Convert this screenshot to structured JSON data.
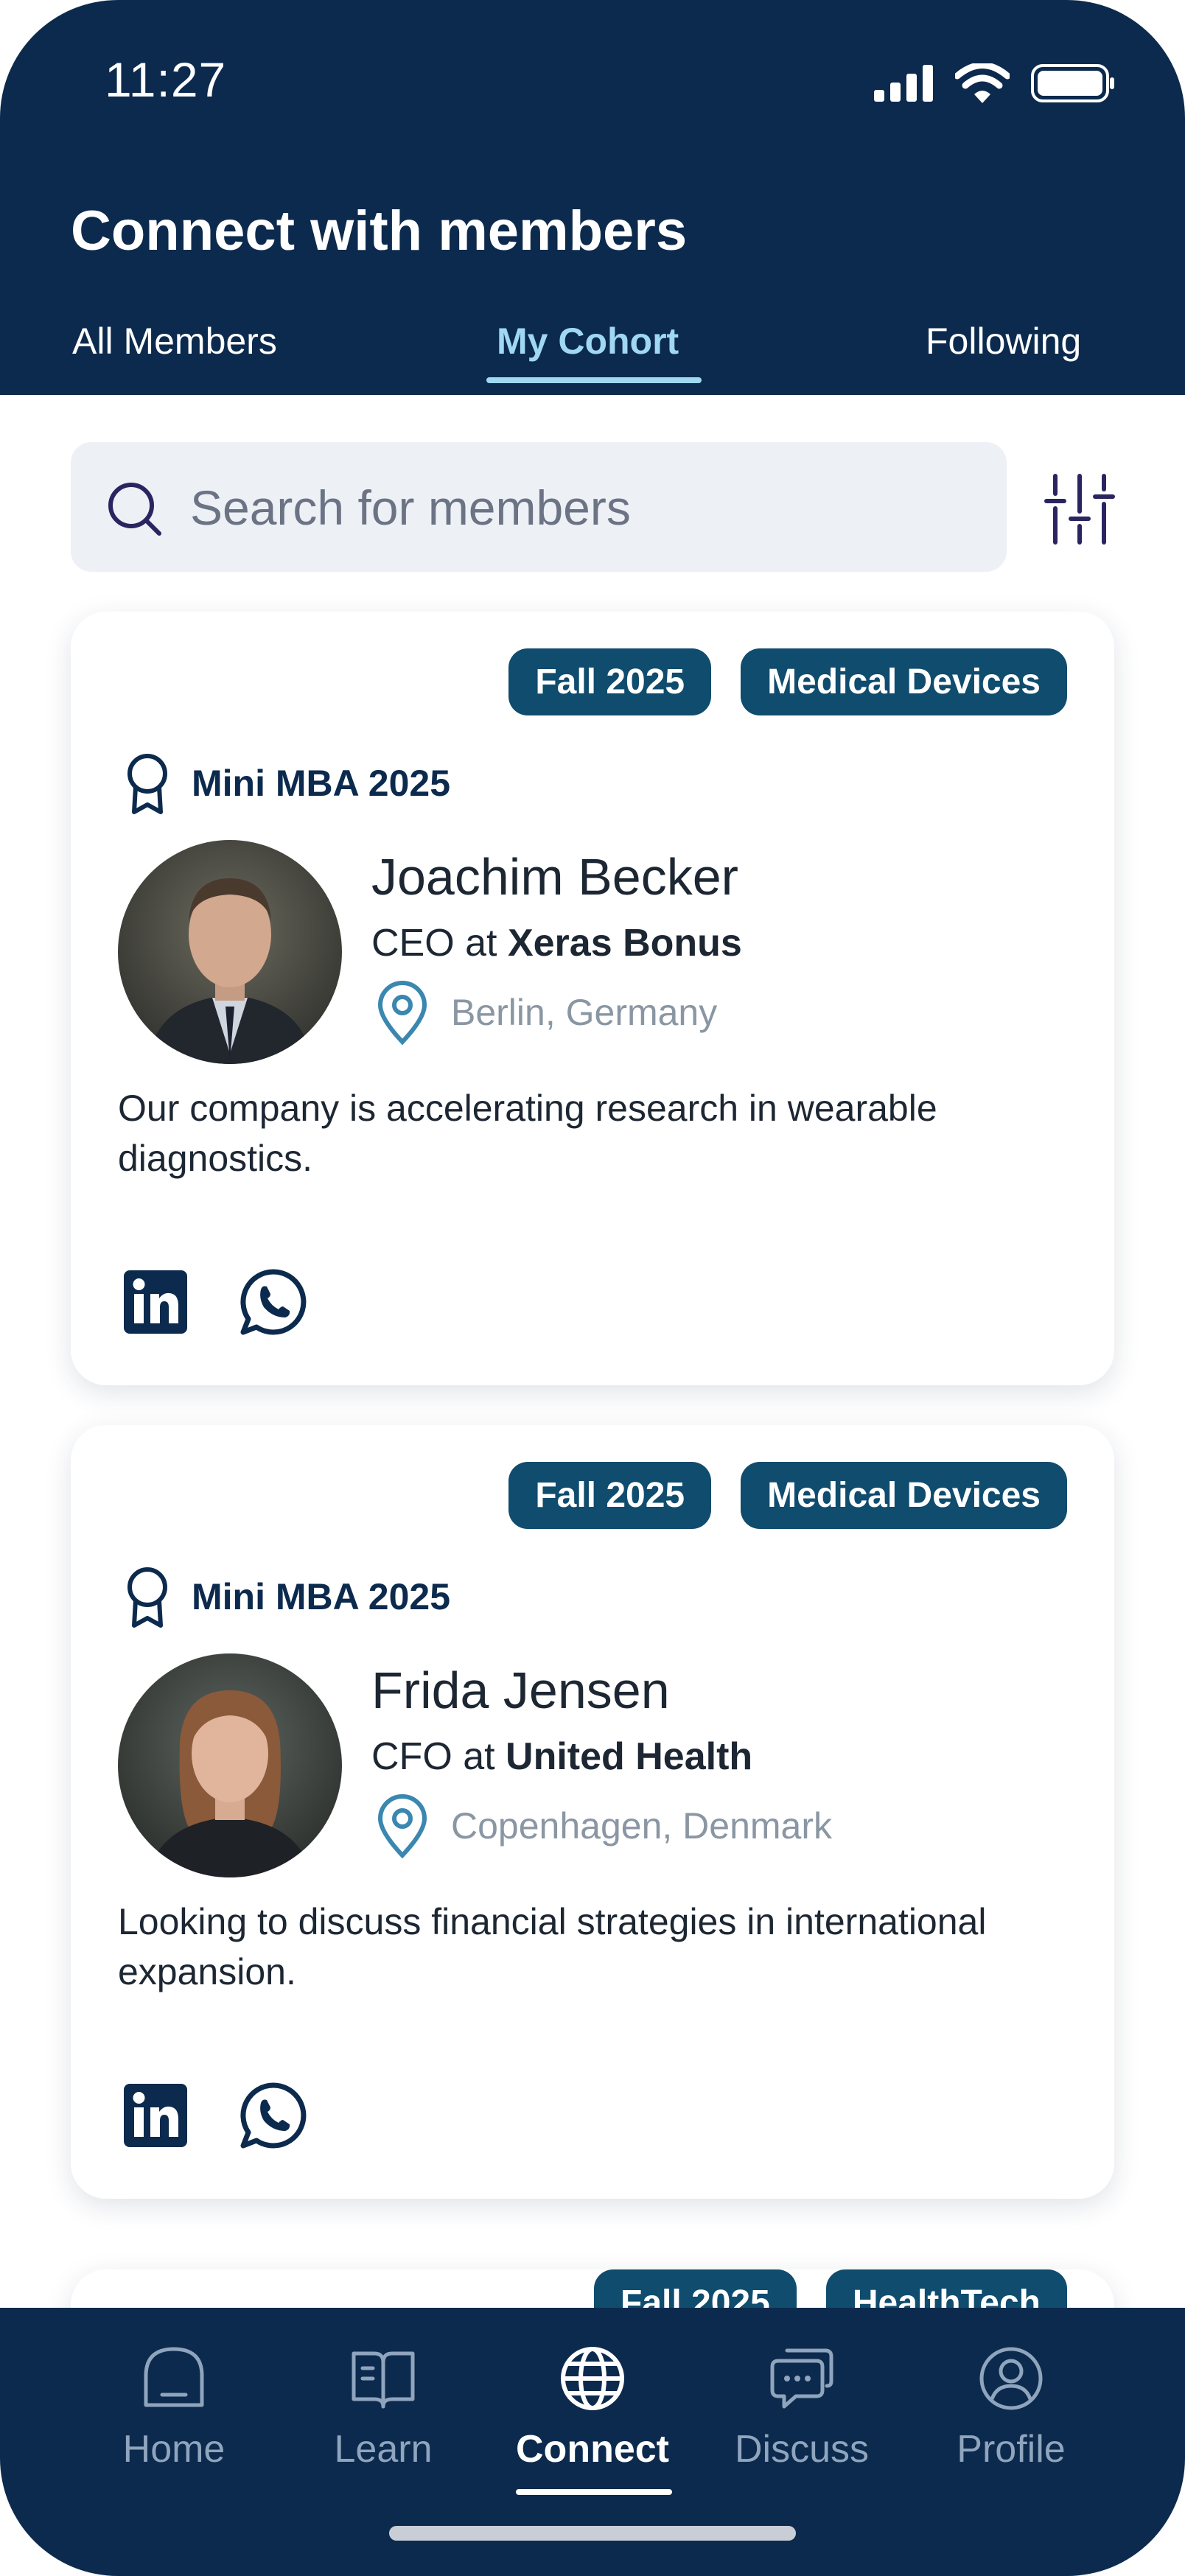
{
  "status_bar": {
    "time": "11:27"
  },
  "header": {
    "title": "Connect with members"
  },
  "tabs": [
    {
      "label": "All Members"
    },
    {
      "label": "My Cohort"
    },
    {
      "label": "Following"
    }
  ],
  "active_tab": "My Cohort",
  "search": {
    "placeholder": "Search for members"
  },
  "members": [
    {
      "tags": [
        "Fall 2025",
        "Medical Devices"
      ],
      "program": "Mini MBA 2025",
      "name": "Joachim Becker",
      "role_prefix": "CEO at",
      "company": "Xeras Bonus",
      "location": "Berlin, Germany",
      "bio": "Our company is accelerating research in wearable diagnostics."
    },
    {
      "tags": [
        "Fall 2025",
        "Medical Devices"
      ],
      "program": "Mini MBA 2025",
      "name": "Frida Jensen",
      "role_prefix": "CFO at",
      "company": "United Health",
      "location": "Copenhagen, Denmark",
      "bio": "Looking to discuss financial strategies in international expansion."
    }
  ],
  "peek_member": {
    "tags": [
      "Fall 2025",
      "HealthTech"
    ]
  },
  "bottom_nav": [
    {
      "label": "Home",
      "icon": "home-icon"
    },
    {
      "label": "Learn",
      "icon": "book-icon"
    },
    {
      "label": "Connect",
      "icon": "globe-icon"
    },
    {
      "label": "Discuss",
      "icon": "chat-icon"
    },
    {
      "label": "Profile",
      "icon": "user-icon"
    }
  ],
  "active_nav": "Connect",
  "colors": {
    "header_bg": "#0c2a4d",
    "tag_bg": "#0f4c6e",
    "active_tab": "#9fd8f0",
    "location_pin": "#3a87b0"
  }
}
